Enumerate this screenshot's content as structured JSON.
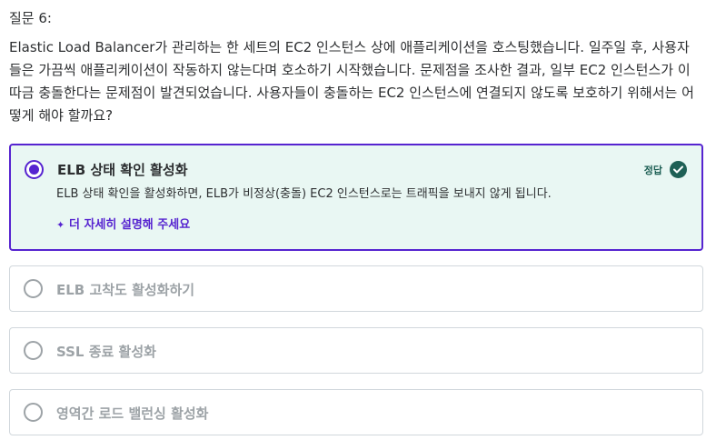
{
  "question": {
    "number": "질문 6:",
    "text": "Elastic Load Balancer가 관리하는 한 세트의 EC2 인스턴스 상에 애플리케이션을 호스팅했습니다. 일주일 후, 사용자들은 가끔씩 애플리케이션이 작동하지 않는다며 호소하기 시작했습니다. 문제점을 조사한 결과, 일부 EC2 인스턴스가 이따금 충돌한다는 문제점이 발견되었습니다. 사용자들이 충돌하는 EC2 인스턴스에 연결되지 않도록 보호하기 위해서는 어떻게 해야 할까요?"
  },
  "options": [
    {
      "label": "ELB 상태 확인 활성화",
      "correct": true,
      "badge": "정답",
      "explanation": "ELB 상태 확인을 활성화하면, ELB가 비정상(충돌) EC2 인스턴스로는 트래픽을 보내지 않게 됩니다.",
      "ai_link": "더 자세히 설명해 주세요"
    },
    {
      "label": "ELB 고착도 활성화하기",
      "correct": false
    },
    {
      "label": "SSL 종료 활성화",
      "correct": false
    },
    {
      "label": "영역간 로드 밸런싱 활성화",
      "correct": false
    }
  ],
  "colors": {
    "accent": "#5624d0",
    "correct_bg": "#e9f7f3",
    "correct_badge": "#1e6055",
    "muted": "#9da3a7"
  },
  "icons": {
    "selected_radio": "radio-selected-icon",
    "correct": "check-circle-icon",
    "ai": "sparkle-icon"
  }
}
